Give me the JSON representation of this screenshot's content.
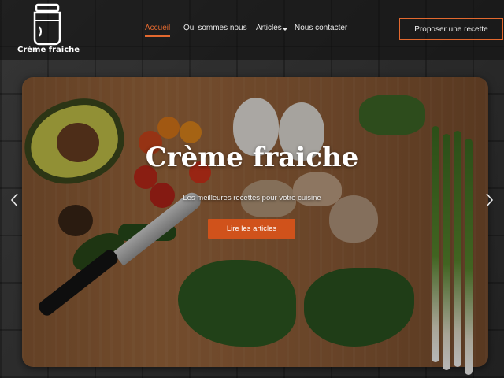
{
  "brand": {
    "logo_text": "Crème fraiche",
    "logo_icon": "jar-icon"
  },
  "nav": {
    "items": [
      {
        "label": "Accueil",
        "active": true
      },
      {
        "label": "Qui sommes nous",
        "active": false
      },
      {
        "label": "Articles",
        "active": false,
        "has_dropdown": true
      },
      {
        "label": "Nous contacter",
        "active": false
      }
    ],
    "cta_label": "Proposer une recette",
    "accent_color": "#e3692f"
  },
  "hero": {
    "title": "Crème fraiche",
    "subtitle": "Les meilleures recettes pour votre cuisine",
    "button_label": "Lire les articles",
    "button_color": "#d0521b"
  },
  "carousel": {
    "prev_icon": "chevron-left-icon",
    "next_icon": "chevron-right-icon"
  }
}
